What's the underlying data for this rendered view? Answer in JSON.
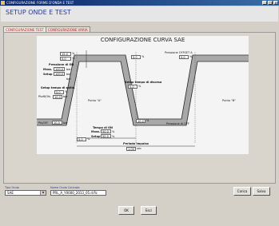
{
  "window": {
    "title": "CONFIGURAZIONE FORME D'ONDA E TEST",
    "min": "_",
    "max": "□",
    "close": "x"
  },
  "header": {
    "title": "SETUP ONDE E TEST"
  },
  "tabs": [
    {
      "label": "CONFIGURAZIONE TEST"
    },
    {
      "label": "CONFIGURAZIONE VARIA"
    }
  ],
  "diagram": {
    "title": "CONFIGURAZIONE CURVA SAE",
    "top_left_box1": "15.0",
    "top_left_box2": "5.0",
    "pct": "%",
    "pressure_on_label": "Pressione di ON",
    "max_label": "Mass.",
    "max_value": "100.0",
    "bar": "bar",
    "setup_label": "Setup",
    "setup_value": "100.0",
    "setup_rise_label": "Setup tempo di salita",
    "setup_rise_value": "5.0",
    "ptoff_label": "Ptoff/Ofs",
    "ptoff_value": "10.0",
    "point_a_label": "Punto \"A\"",
    "top_right_box": "5.0",
    "pressure_offset_label": "Pressione OFFSET A",
    "pressure_offset_value": "5.0",
    "setup_fall_label": "Setup tempo di discesa",
    "setup_fall_value": "5.0",
    "point_b_label": "Punto \"B\"",
    "pressure_off_label": "Pressione di OFF",
    "ptsoff_label": "Pts/Off",
    "ptsoff_value": "10.0",
    "bottom_box_mid": "10.0",
    "bottom_box_left": "5.0",
    "ton_label": "Tempo di ON",
    "ton_max_label": "Mass.",
    "ton_max_value": "50.0",
    "ton_setup_label": "Setup",
    "ton_setup_value": "50.0",
    "period_label": "Periodo impulso",
    "period_value": "1.00",
    "sec": "sec"
  },
  "footer": {
    "tipo_onda_label": "Tipo Onda",
    "tipo_onda_value": "SAE",
    "nome_onda_label": "Nome Onda Caricata",
    "nome_onda_value": "PRL_A_Y0000_2013_05.d.flc",
    "carica": "Carica",
    "salva": "Salva",
    "ok": "OK",
    "esci": "Esci"
  }
}
